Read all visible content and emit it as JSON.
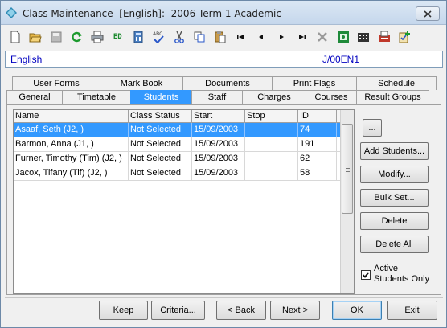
{
  "window": {
    "title": "Class Maintenance  [English]:  2006 Term 1 Academic",
    "close_label": "close"
  },
  "toolbar": {
    "icons": [
      "new-icon",
      "open-icon",
      "save-icon",
      "refresh-icon",
      "print-icon",
      "edit-icon",
      "calculator-icon",
      "spellcheck-icon",
      "cut-icon",
      "copy-icon",
      "paste-icon",
      "first-record-icon",
      "previous-record-icon",
      "next-record-icon",
      "last-record-icon",
      "delete-icon",
      "find-icon",
      "filter-icon",
      "print-setup-icon",
      "clipboard-icon"
    ],
    "edit_label": "ED"
  },
  "info": {
    "class_name": "English",
    "class_code": "J/00EN1"
  },
  "tabs_top": [
    {
      "label": "User Forms"
    },
    {
      "label": "Mark Book"
    },
    {
      "label": "Documents"
    },
    {
      "label": "Print Flags"
    },
    {
      "label": "Schedule"
    }
  ],
  "tabs_bottom": [
    {
      "label": "General"
    },
    {
      "label": "Timetable"
    },
    {
      "label": "Students",
      "active": true
    },
    {
      "label": "Staff"
    },
    {
      "label": "Charges"
    },
    {
      "label": "Courses"
    },
    {
      "label": "Result Groups"
    }
  ],
  "grid": {
    "columns": [
      "Name",
      "Class Status",
      "Start",
      "Stop",
      "ID"
    ],
    "rows": [
      {
        "name": "Asaaf, Seth (J2, )",
        "status": "Not Selected",
        "start": "15/09/2003",
        "stop": "",
        "id": "74",
        "selected": true
      },
      {
        "name": "Barmon, Anna (J1, )",
        "status": "Not Selected",
        "start": "15/09/2003",
        "stop": "",
        "id": "191"
      },
      {
        "name": "Furner, Timothy (Tim) (J2, )",
        "status": "Not Selected",
        "start": "15/09/2003",
        "stop": "",
        "id": "62"
      },
      {
        "name": "Jacox, Tifany (Tif) (J2, )",
        "status": "Not Selected",
        "start": "15/09/2003",
        "stop": "",
        "id": "58"
      }
    ]
  },
  "side_buttons": {
    "more": "...",
    "add_students": "Add Students...",
    "modify": "Modify...",
    "bulk_set": "Bulk Set...",
    "delete": "Delete",
    "delete_all": "Delete All"
  },
  "active_students": {
    "label_line1": "Active",
    "label_line2": "Students Only",
    "checked": true
  },
  "bottom_buttons": {
    "keep": "Keep",
    "criteria": "Criteria...",
    "back": "< Back",
    "next": "Next >",
    "ok": "OK",
    "exit": "Exit"
  },
  "colors": {
    "selection": "#3399ff",
    "info_text": "#0000c0",
    "title_bar": "#c5d7ec"
  }
}
